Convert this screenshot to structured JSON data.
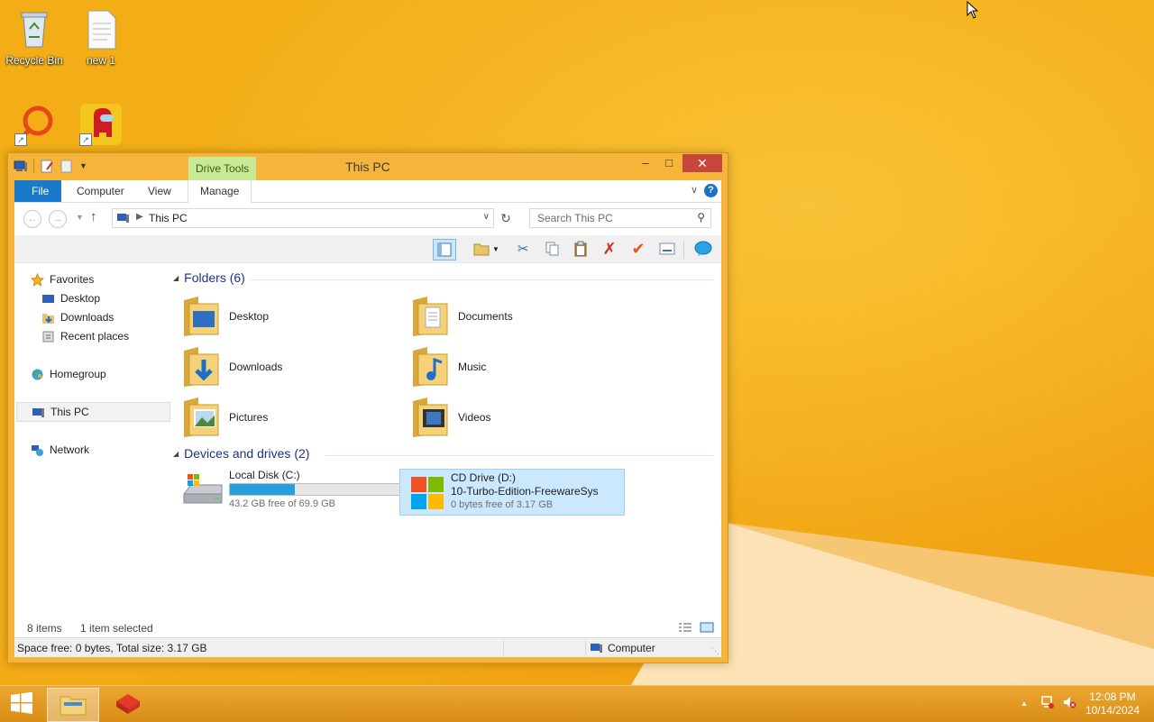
{
  "desktop": {
    "icons": [
      {
        "label": "Recycle Bin",
        "icon": "recycle-bin-icon"
      },
      {
        "label": "new 1",
        "icon": "text-file-icon"
      },
      {
        "label": "",
        "icon": "app-shortcut-icon"
      },
      {
        "label": "",
        "icon": "among-us-shortcut-icon"
      }
    ]
  },
  "window": {
    "title": "This PC",
    "context_tab": "Drive Tools",
    "controls": {
      "minimize": "–",
      "maximize": "□",
      "close": "✕"
    },
    "ribbon_tabs": [
      "File",
      "Computer",
      "View",
      "Manage"
    ],
    "help": "?",
    "address": {
      "path": "This PC",
      "search_placeholder": "Search This PC"
    },
    "nav_pane": {
      "favorites": "Favorites",
      "favorites_items": [
        "Desktop",
        "Downloads",
        "Recent places"
      ],
      "homegroup": "Homegroup",
      "this_pc": "This PC",
      "network": "Network"
    },
    "folders_header": "Folders (6)",
    "folders": [
      {
        "name": "Desktop",
        "icon": "desktop-folder-icon"
      },
      {
        "name": "Documents",
        "icon": "documents-folder-icon"
      },
      {
        "name": "Downloads",
        "icon": "downloads-folder-icon"
      },
      {
        "name": "Music",
        "icon": "music-folder-icon"
      },
      {
        "name": "Pictures",
        "icon": "pictures-folder-icon"
      },
      {
        "name": "Videos",
        "icon": "videos-folder-icon"
      }
    ],
    "drives_header": "Devices and drives (2)",
    "drives": [
      {
        "name": "Local Disk (C:)",
        "label": "",
        "free_text": "43.2 GB free of 69.9 GB",
        "used_fraction": 0.382
      },
      {
        "name": "CD Drive (D:)",
        "label": "10-Turbo-Edition-FreewareSys",
        "free_text": "0 bytes free of 3.17 GB"
      }
    ],
    "status": {
      "items": "8 items",
      "selected": "1 item selected",
      "space": "Space free: 0 bytes, Total size: 3.17 GB",
      "location": "Computer"
    }
  },
  "taskbar": {
    "time": "12:08 PM",
    "date": "10/14/2024",
    "tray_expand": "▲"
  }
}
